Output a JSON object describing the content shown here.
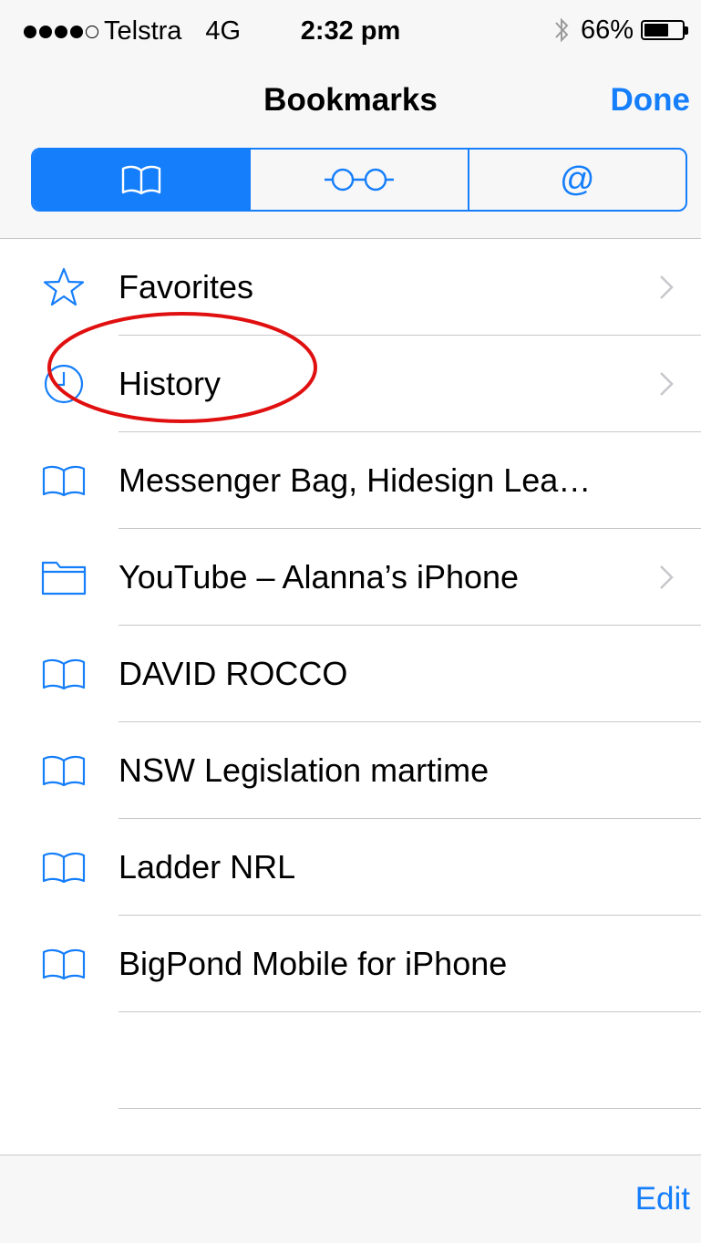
{
  "status": {
    "carrier": "Telstra",
    "network": "4G",
    "time": "2:32 pm",
    "battery": "66%",
    "battery_level": 0.66,
    "signal_bars_filled": 4,
    "signal_bars_total": 5
  },
  "nav": {
    "title": "Bookmarks",
    "done_label": "Done"
  },
  "tabs": [
    {
      "icon": "bookmarks-book-icon",
      "selected": true
    },
    {
      "icon": "reading-list-glasses-icon",
      "selected": false
    },
    {
      "icon": "shared-links-at-icon",
      "selected": false,
      "glyph": "@"
    }
  ],
  "bookmarks": [
    {
      "icon": "star-icon",
      "label": "Favorites",
      "chevron": true
    },
    {
      "icon": "clock-icon",
      "label": "History",
      "chevron": true
    },
    {
      "icon": "book-icon",
      "label": "Messenger Bag, Hidesign Lea…",
      "chevron": false
    },
    {
      "icon": "folder-icon",
      "label": "YouTube – Alanna’s iPhone",
      "chevron": true
    },
    {
      "icon": "book-icon",
      "label": "DAVID ROCCO",
      "chevron": false
    },
    {
      "icon": "book-icon",
      "label": "NSW Legislation martime",
      "chevron": false
    },
    {
      "icon": "book-icon",
      "label": "Ladder NRL",
      "chevron": false
    },
    {
      "icon": "book-icon",
      "label": "BigPond Mobile for iPhone",
      "chevron": false
    }
  ],
  "toolbar": {
    "edit_label": "Edit"
  },
  "colors": {
    "accent": "#157efb",
    "annotation": "#e01010",
    "separator": "#c8c7cc",
    "bar_background": "#f7f7f8"
  }
}
